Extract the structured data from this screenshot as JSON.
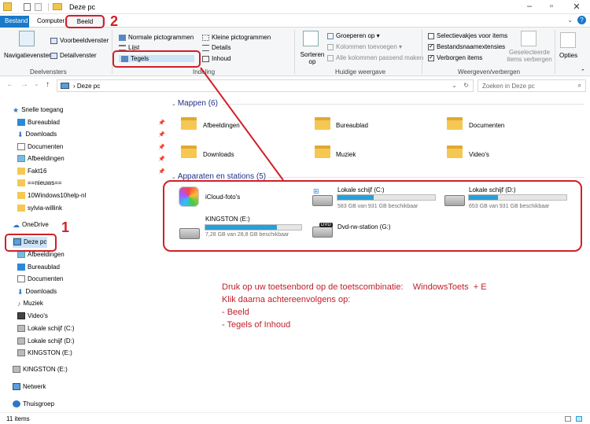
{
  "window": {
    "title": "Deze pc"
  },
  "menu": {
    "tabs": [
      "Bestand",
      "Computer",
      "Beeld"
    ]
  },
  "ribbon": {
    "deelvensters": {
      "navigatievenster": "Navigatievenster",
      "voorbeeldvenster": "Voorbeeldvenster",
      "detailvenster": "Detailvenster",
      "label": "Deelvensters"
    },
    "indeling": {
      "items": [
        "Normale pictogrammen",
        "Kleine pictogrammen",
        "Lijst",
        "Details",
        "Tegels",
        "Inhoud"
      ],
      "label": "Indeling"
    },
    "huidige": {
      "sorteren": "Sorteren op",
      "groeperen": "Groeperen op",
      "kolommen": "Kolommen toevoegen",
      "passend": "Alle kolommen passend maken",
      "label": "Huidige weergave"
    },
    "weergeven": {
      "selectievakjes": "Selectievakjes voor items",
      "extensies": "Bestandsnaamextensies",
      "verborgen": "Verborgen items",
      "geselecteerde": "Geselecteerde items verbergen",
      "label": "Weergeven/verbergen"
    },
    "opties": "Opties"
  },
  "address": {
    "path": "Deze pc",
    "search_placeholder": "Zoeken in Deze pc"
  },
  "sidebar": {
    "snelle": "Snelle toegang",
    "quick": [
      "Bureaublad",
      "Downloads",
      "Documenten",
      "Afbeeldingen",
      "Fakt16",
      "==nieuws==",
      "10Windows10help-nl",
      "sylvia-willink"
    ],
    "onedrive": "OneDrive",
    "dezepc": "Deze pc",
    "pc": [
      "Afbeeldingen",
      "Bureaublad",
      "Documenten",
      "Downloads",
      "Muziek",
      "Video's",
      "Lokale schijf (C:)",
      "Lokale schijf (D:)",
      "KINGSTON (E:)"
    ],
    "kingston": "KINGSTON (E:)",
    "netwerk": "Netwerk",
    "thuisgroep": "Thuisgroep"
  },
  "content": {
    "mappen_header": "Mappen (6)",
    "folders": [
      "Afbeeldingen",
      "Bureaublad",
      "Documenten",
      "Downloads",
      "Muziek",
      "Video's"
    ],
    "apparaten_header": "Apparaten en stations (5)",
    "icloud": "iCloud-foto's",
    "c": {
      "name": "Lokale schijf (C:)",
      "free": "583 GB van 931 GB beschikbaar",
      "used": 0.374
    },
    "d": {
      "name": "Lokale schijf (D:)",
      "free": "653 GB van 931 GB beschikbaar",
      "used": 0.3
    },
    "e": {
      "name": "KINGSTON (E:)",
      "free": "7,28 GB van 28,8 GB beschikbaar",
      "used": 0.747
    },
    "g": {
      "name": "Dvd-rw-station (G:)"
    }
  },
  "status": {
    "items": "11 items"
  },
  "annotation": {
    "num1": "1",
    "num2": "2",
    "lines": [
      "Druk op uw toetsenbord op de toetscombinatie:    WindowsToets  + E",
      "Klik daarna achtereenvolgens op:",
      "- Beeld",
      "- Tegels of Inhoud"
    ]
  },
  "colors": {
    "accent": "#1979ca",
    "annotation_red": "#d0202a",
    "drive_bar": "#26a0da",
    "folder": "#f5c853"
  }
}
